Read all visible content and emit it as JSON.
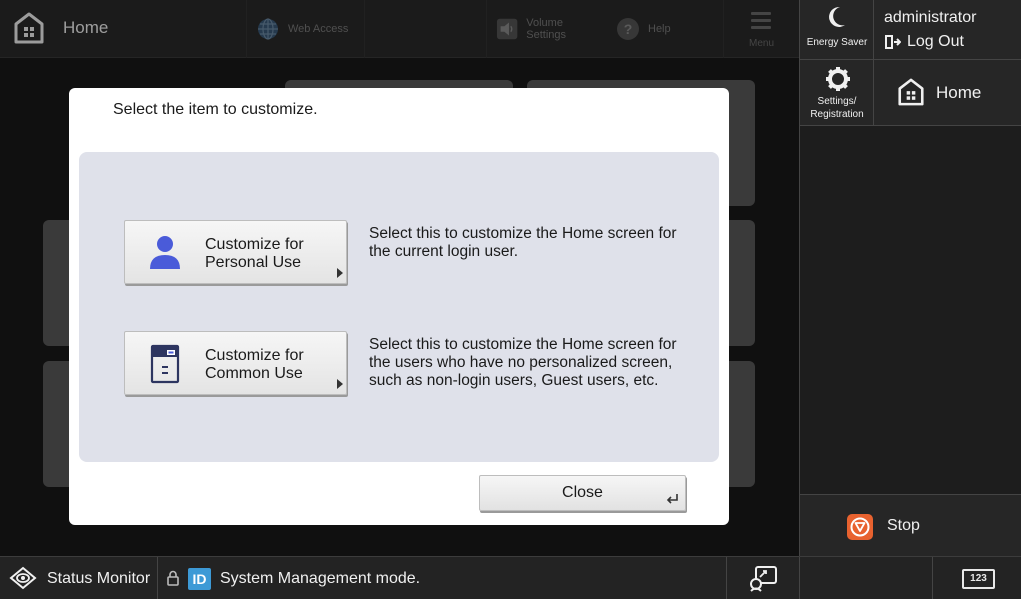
{
  "topbar": {
    "home_label": "Home",
    "web_access_label": "Web Access",
    "volume_label": "Volume Settings",
    "help_label": "Help",
    "menu_label": "Menu"
  },
  "right_panel": {
    "energy_saver_label": "Energy Saver",
    "user_name": "administrator",
    "logout_label": "Log Out",
    "settings_label_line1": "Settings/",
    "settings_label_line2": "Registration",
    "home_label": "Home",
    "stop_label": "Stop"
  },
  "dialog": {
    "title": "Select the item to customize.",
    "options": [
      {
        "label_line1": "Customize for",
        "label_line2": "Personal Use",
        "description_line1": "Select this to customize the Home screen for",
        "description_line2": "the current login user.",
        "description_line3": ""
      },
      {
        "label_line1": "Customize for",
        "label_line2": "Common Use",
        "description_line1": "Select this to customize the Home screen for",
        "description_line2": "the users who have no personalized screen,",
        "description_line3": "such as non-login users, Guest users, etc."
      }
    ],
    "close_label": "Close"
  },
  "statusbar": {
    "status_monitor_label": "Status Monitor",
    "id_badge": "ID",
    "mode_text": "System Management mode.",
    "keyboard_label": "123"
  },
  "colors": {
    "accent_user_icon": "#4a5bd9",
    "stop_button": "#e8622f",
    "id_badge": "#3d9ad6"
  }
}
